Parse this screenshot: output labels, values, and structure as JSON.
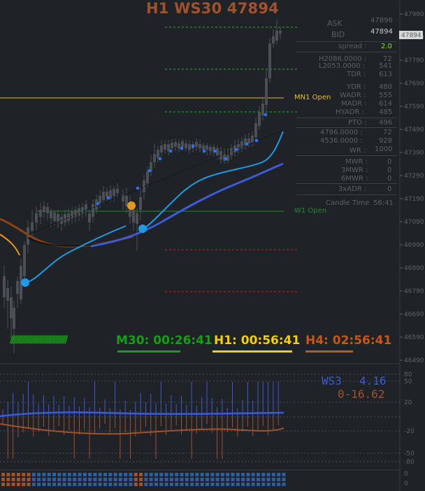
{
  "header": {
    "title": "H1 WS30 47894"
  },
  "colors": {
    "background": "#1f2226",
    "candle": "#4b5057",
    "title": "#a0522d",
    "mn1_line": "#e6c020",
    "w1_line": "#1a8f2a",
    "upper_levels": "#1fb51f",
    "lower_levels": "#d01e1e",
    "ma_brown": "#8b4513",
    "ma_light_blue": "#1e9be6",
    "ma_blue": "#3b5bd9",
    "ma_orange": "#e69a1a",
    "signal_dot": "#2a6fff",
    "m30_color": "#16a016",
    "h1_color": "#f5d000",
    "h4_color": "#c8561a"
  },
  "price_axis": {
    "labels": [
      "47990",
      "47890",
      "47790",
      "47690",
      "47590",
      "47490",
      "47390",
      "47290",
      "47190",
      "47090",
      "46990",
      "46890",
      "46790",
      "46690",
      "46590",
      "46490"
    ],
    "current_price_label": "47894"
  },
  "lines": {
    "mn1_label": "MN1 Open",
    "w1_label": "W1 Open"
  },
  "info_panel": {
    "ask_label": "ASK",
    "ask_value": "47896",
    "bid_label": "BID",
    "bid_value": "47894",
    "spread_label": "spread :",
    "spread_value": "2.0",
    "h_overlap_a": "H2086.0000 :",
    "h_overlap_b": "L2053.0000 :",
    "h_val_1": "72",
    "h_val_2": "541",
    "tdr_label": "TDR :",
    "tdr_value": "613",
    "ydr_label": "YDR :",
    "ydr_value": "480",
    "wadr_label": "WADR :",
    "wadr_value": "555",
    "madr_label": "MADR :",
    "madr_value": "614",
    "hyadr_label": "HYADR :",
    "hyadr_value": "485",
    "pto_label": "PTO :",
    "pto_value": "496",
    "w_overlap_a": "4786.0000 :",
    "w_overlap_b": "4536.0000 :",
    "w_val_1": "72",
    "w_val_2": "928",
    "wr_label": "WR :",
    "wr_value": "1000",
    "mwr_label": "MWR :",
    "mwr_value": "0",
    "mwr3_label": "3MWR :",
    "mwr3_value": "0",
    "mwr6_label": "6MWR :",
    "mwr6_value": "0",
    "adr3_label": "3xADR :",
    "adr3_value": "0",
    "candle_time_label": "Candle Time",
    "candle_time_value": "56:41"
  },
  "timers": {
    "m30": "M30: 00:26:41",
    "h1": "H1: 00:56:41",
    "h4": "H4: 02:56:41"
  },
  "indicator": {
    "ws3_label": "WS3",
    "ws3_value": "4.16",
    "second_value": "0-16.62",
    "axis_labels": [
      "80",
      "50",
      "20",
      "-20",
      "-50",
      "-80"
    ],
    "bottom_labels": [
      "0",
      "0"
    ]
  }
}
